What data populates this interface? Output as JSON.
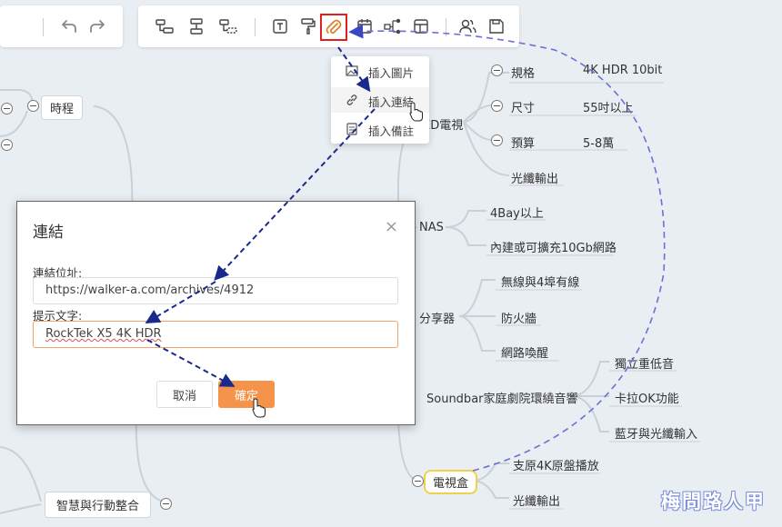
{
  "toolbar": {
    "icons": [
      "undo-icon",
      "redo-icon",
      "child-node-icon",
      "sibling-node-icon",
      "parent-node-icon",
      "text-icon",
      "format-painter-icon",
      "attachment-icon",
      "calendar-icon",
      "relation-icon",
      "layout-icon",
      "collaborators-icon",
      "save-icon"
    ]
  },
  "menu": {
    "insert_image": "插入圖片",
    "insert_link": "插入連結",
    "insert_note": "插入備註"
  },
  "dialog": {
    "title": "連結",
    "close": "×",
    "url_label": "連結位址:",
    "url_value": "https://walker-a.com/archives/4912",
    "text_label": "提示文字:",
    "text_value": "RockTek X5 4K HDR",
    "cancel": "取消",
    "confirm": "確定"
  },
  "mindmap": {
    "schedule": "時程",
    "smart_integration": "智慧與行動整合",
    "led_tv": "LED電視",
    "led_tv_partial": "ED電視",
    "spec": "規格",
    "spec_value": "4K HDR 10bit",
    "size": "尺寸",
    "size_value": "55吋以上",
    "budget": "預算",
    "budget_value": "5-8萬",
    "optical_out": "光纖輸出",
    "nas": "NAS",
    "nas_4bay": "4Bay以上",
    "nas_10gb": "內建或可擴充10Gb網路",
    "hub": "分享器",
    "hub_ports": "無線與4埠有線",
    "firewall": "防火牆",
    "wol": "網路喚醒",
    "soundbar": "Soundbar家庭劇院環繞音響",
    "subwoofer": "獨立重低音",
    "karaoke": "卡拉OK功能",
    "bt_optical": "藍牙與光纖輸入",
    "tvbox": "電視盒",
    "tvbox_4k": "支原4K原盤播放",
    "tvbox_optical": "光纖輸出"
  },
  "watermark": "梅問路人甲",
  "colors": {
    "accent_orange": "#f5934a",
    "highlight_red": "#e02020",
    "arrow_blue": "#1a2a8c",
    "curve_blue": "#6d6fd6",
    "tvbox_highlight": "#f2d04a"
  }
}
